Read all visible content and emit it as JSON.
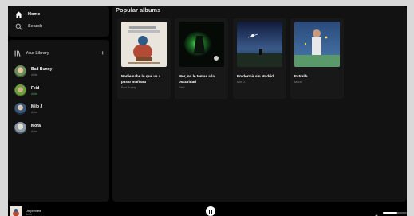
{
  "sidebar": {
    "nav": [
      {
        "label": "Home",
        "icon": "home-icon"
      },
      {
        "label": "Search",
        "icon": "search-icon"
      }
    ],
    "library": {
      "label": "Your Library",
      "add_icon": "plus-icon",
      "artists": [
        {
          "name": "Bad Bunny",
          "sub": "Artist"
        },
        {
          "name": "Feid",
          "sub": "Artist"
        },
        {
          "name": "Milo J",
          "sub": "Artist"
        },
        {
          "name": "Mora",
          "sub": "Artist"
        }
      ]
    }
  },
  "main": {
    "section_title": "Popular albums",
    "albums": [
      {
        "title": "Nadie sabe lo que va a pasar mañana",
        "artist": "Bad Bunny"
      },
      {
        "title": "Mor, no le temas a la oscuridad",
        "artist": "Feid"
      },
      {
        "title": "En dormir sin Madrid",
        "artist": "Milo J"
      },
      {
        "title": "Estrella",
        "artist": "Mora"
      }
    ]
  },
  "player": {
    "track_title": "Un preview",
    "track_artist": "Artist",
    "state_icon": "pause-icon",
    "volume_icon": "speaker-icon",
    "volume_level": 0.6
  },
  "colors": {
    "accent": "#1db954",
    "background": "#121212",
    "card": "#181818"
  }
}
